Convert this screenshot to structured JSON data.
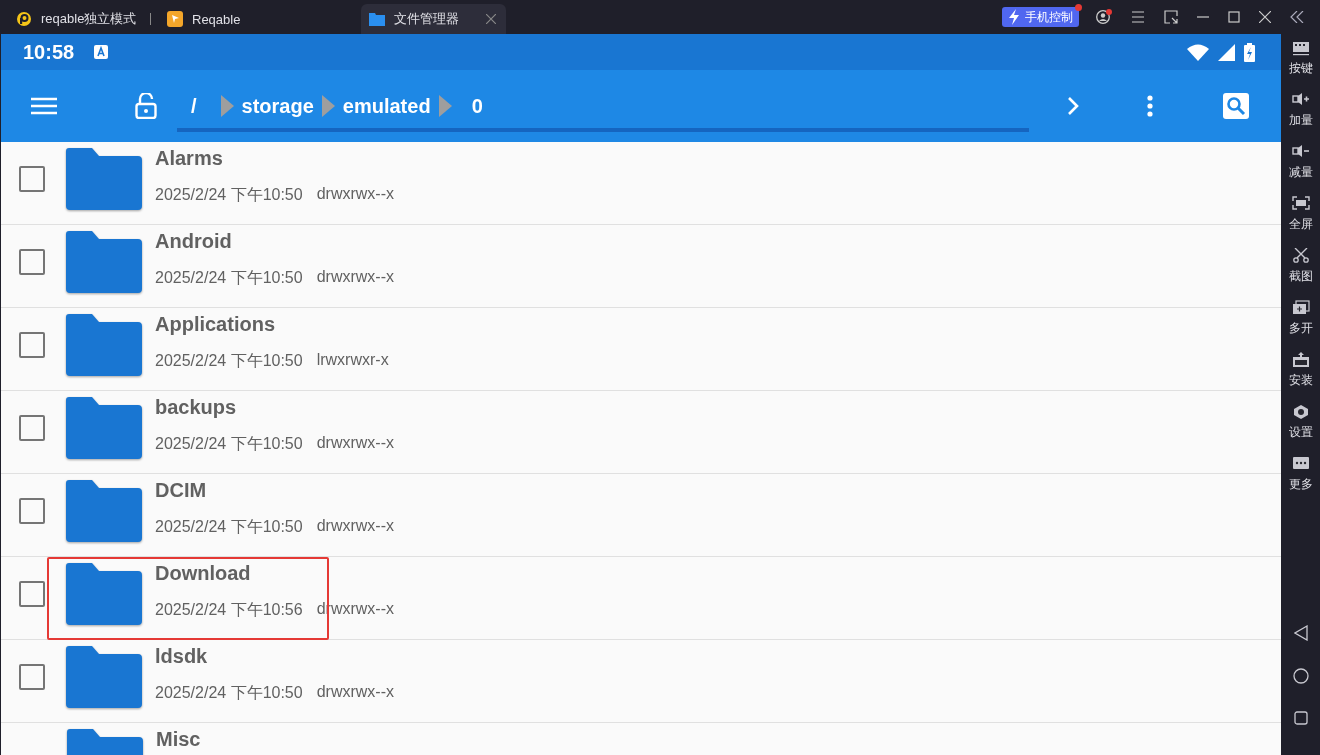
{
  "window": {
    "tabs": [
      {
        "label": "reqable独立模式",
        "selected": false
      },
      {
        "label": "Reqable",
        "selected": false
      },
      {
        "label": "文件管理器",
        "selected": true
      }
    ],
    "phone_control": "手机控制",
    "notifications": true
  },
  "status_bar": {
    "time": "10:58"
  },
  "toolbar": {
    "breadcrumb": [
      "/",
      "storage",
      "emulated",
      "0"
    ]
  },
  "files": [
    {
      "name": "Alarms",
      "date": "2025/2/24 下午10:50",
      "permissions": "drwxrwx--x",
      "checked": false,
      "highlighted": false
    },
    {
      "name": "Android",
      "date": "2025/2/24 下午10:50",
      "permissions": "drwxrwx--x",
      "checked": false,
      "highlighted": false
    },
    {
      "name": "Applications",
      "date": "2025/2/24 下午10:50",
      "permissions": "lrwxrwxr-x",
      "checked": false,
      "highlighted": false
    },
    {
      "name": "backups",
      "date": "2025/2/24 下午10:50",
      "permissions": "drwxrwx--x",
      "checked": false,
      "highlighted": false
    },
    {
      "name": "DCIM",
      "date": "2025/2/24 下午10:50",
      "permissions": "drwxrwx--x",
      "checked": false,
      "highlighted": false
    },
    {
      "name": "Download",
      "date": "2025/2/24 下午10:56",
      "permissions": "drwxrwx--x",
      "checked": false,
      "highlighted": true
    },
    {
      "name": "ldsdk",
      "date": "2025/2/24 下午10:50",
      "permissions": "drwxrwx--x",
      "checked": false,
      "highlighted": false
    },
    {
      "name": "Misc"
    }
  ],
  "sidebar": [
    {
      "label": "按键"
    },
    {
      "label": "加量"
    },
    {
      "label": "减量"
    },
    {
      "label": "全屏"
    },
    {
      "label": "截图"
    },
    {
      "label": "多开"
    },
    {
      "label": "安装"
    },
    {
      "label": "设置"
    },
    {
      "label": "更多"
    }
  ]
}
